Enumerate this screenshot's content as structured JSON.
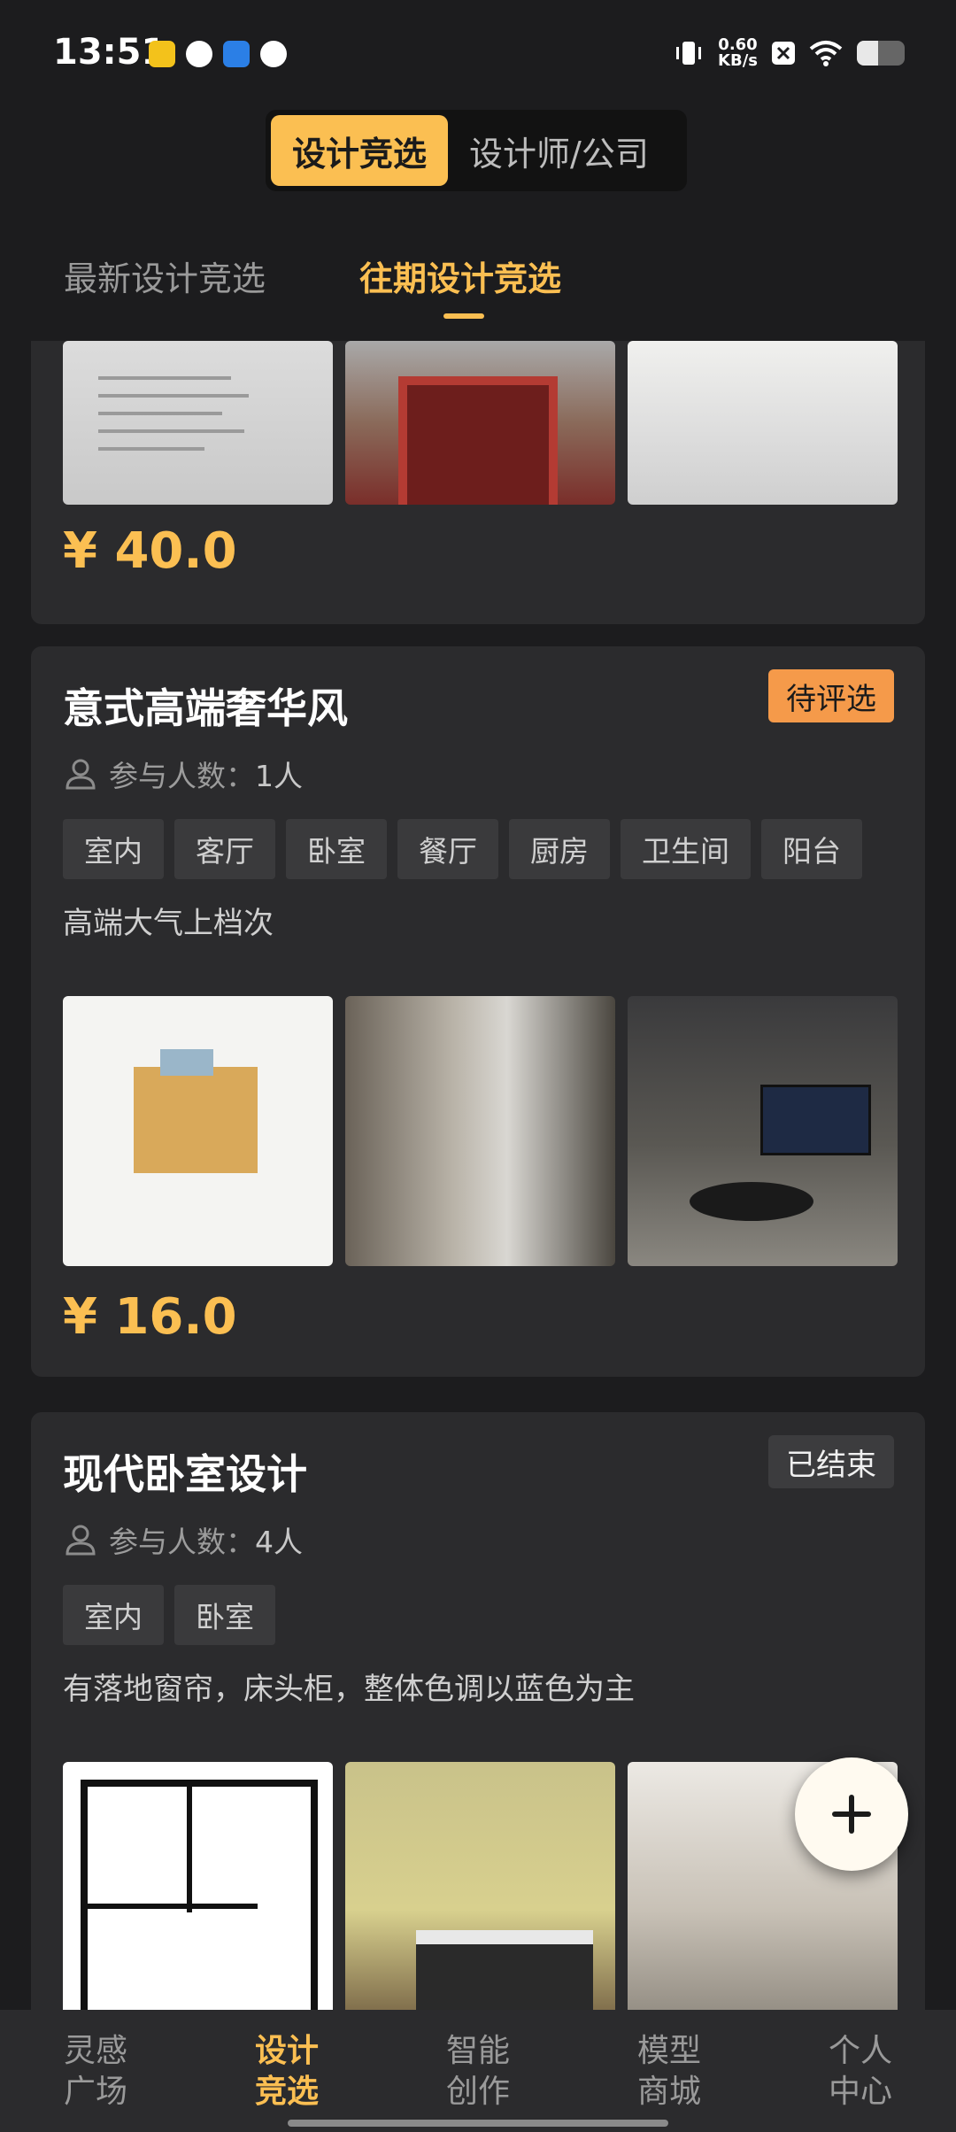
{
  "status_bar": {
    "time": "13:51",
    "net_speed_value": "0.60",
    "net_speed_unit": "KB/s",
    "battery_level": 0.45,
    "icons": [
      "app-icon-yellow",
      "app-icon-swirl",
      "app-icon-blue",
      "app-icon-cat",
      "vibrate-icon",
      "close-box-icon",
      "wifi-icon",
      "battery-icon"
    ]
  },
  "segment": {
    "items": [
      {
        "label": "设计竞选",
        "active": true
      },
      {
        "label": "设计师/公司",
        "active": false
      }
    ]
  },
  "tabs": {
    "items": [
      {
        "label": "最新设计竞选",
        "active": false
      },
      {
        "label": "往期设计竞选",
        "active": true
      }
    ]
  },
  "cards": [
    {
      "price": "¥ 40.0",
      "images": [
        "document-photo",
        "red-gate-photo",
        "empty-room-photo"
      ]
    },
    {
      "title": "意式高端奢华风",
      "status": "待评选",
      "participants_label": "参与人数：",
      "participants_value": "1人",
      "tags": [
        "室内",
        "客厅",
        "卧室",
        "餐厅",
        "厨房",
        "卫生间",
        "阳台"
      ],
      "description": "高端大气上档次",
      "images": [
        "floor-plan-photo",
        "balcony-photo",
        "living-room-render"
      ],
      "price": "¥ 16.0"
    },
    {
      "title": "现代卧室设计",
      "status": "已结束",
      "participants_label": "参与人数：",
      "participants_value": "4人",
      "tags": [
        "室内",
        "卧室"
      ],
      "description": "有落地窗帘，床头柜，整体色调以蓝色为主",
      "images": [
        "floor-plan-drawing",
        "bedroom-render",
        "unfinished-room-photo"
      ]
    }
  ],
  "bottom_nav": {
    "items": [
      {
        "label_line1": "灵感",
        "label_line2": "广场",
        "active": false
      },
      {
        "label_line1": "设计",
        "label_line2": "竞选",
        "active": true
      },
      {
        "label_line1": "智能",
        "label_line2": "创作",
        "active": false
      },
      {
        "label_line1": "模型",
        "label_line2": "商城",
        "active": false
      },
      {
        "label_line1": "个人",
        "label_line2": "中心",
        "active": false
      }
    ]
  },
  "colors": {
    "accent": "#fbbf52",
    "pending_badge": "#f59a4a",
    "background": "#1c1c1e",
    "card": "#2b2b2d"
  }
}
